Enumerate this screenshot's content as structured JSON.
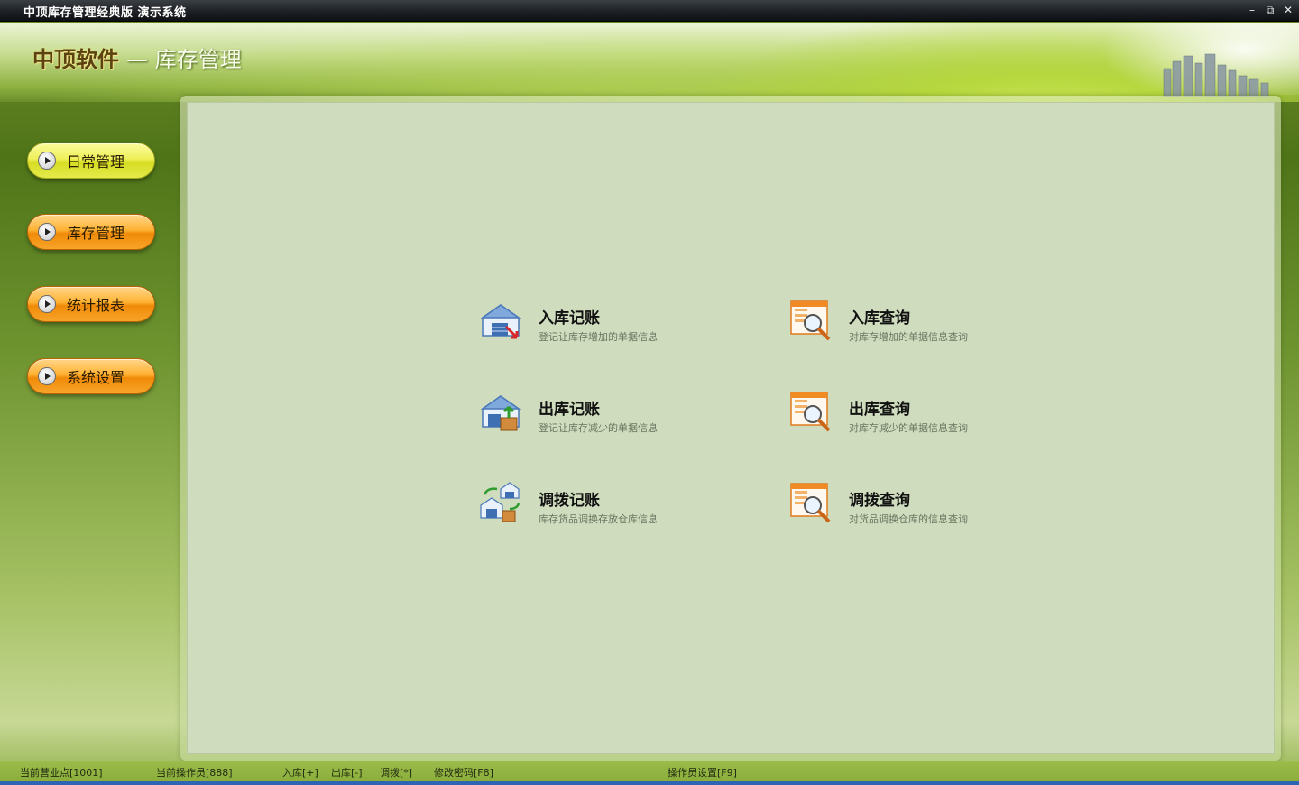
{
  "window": {
    "title": "中顶库存管理经典版  演示系统",
    "buttons": [
      "–",
      "⧉",
      "✕"
    ]
  },
  "header": {
    "brand": "中顶软件",
    "section": "— 库存管理"
  },
  "sidebar": {
    "items": [
      {
        "label": "日常管理"
      },
      {
        "label": "库存管理"
      },
      {
        "label": "统计报表"
      },
      {
        "label": "系统设置"
      }
    ]
  },
  "main": {
    "items": [
      {
        "title": "入库记账",
        "desc": "登记让库存增加的单据信息",
        "icon": "warehouse-in-icon"
      },
      {
        "title": "入库查询",
        "desc": "对库存增加的单据信息查询",
        "icon": "document-search-icon"
      },
      {
        "title": "出库记账",
        "desc": "登记让库存减少的单据信息",
        "icon": "warehouse-out-icon"
      },
      {
        "title": "出库查询",
        "desc": "对库存减少的单据信息查询",
        "icon": "document-search-icon"
      },
      {
        "title": "调拨记账",
        "desc": "库存货品调换存放仓库信息",
        "icon": "warehouse-transfer-icon"
      },
      {
        "title": "调拨查询",
        "desc": "对货品调换仓库的信息查询",
        "icon": "document-search-icon"
      }
    ]
  },
  "status": {
    "branch": "当前营业点[1001]",
    "operator": "当前操作员[888]",
    "in": "入库[+]",
    "out": "出库[-]",
    "transfer": "调拨[*]",
    "password": "修改密码[F8]",
    "operator_settings": "操作员设置[F9]"
  },
  "colors": {
    "panel": "#cfdcbd",
    "nav_active": "#d6dc22",
    "nav_default": "#f08a08",
    "accent_blue": "#2d64b4"
  }
}
